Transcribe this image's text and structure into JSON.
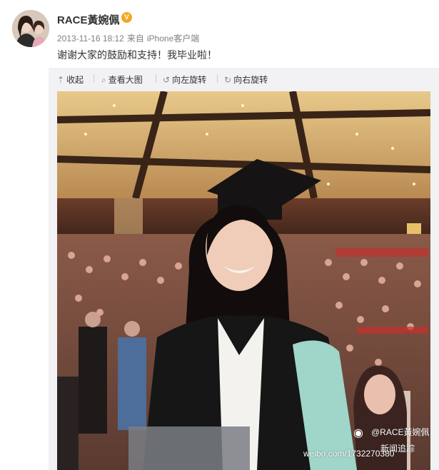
{
  "post": {
    "username": "RACE黃婉佩",
    "verified_icon": "verified-badge-icon",
    "time": "2013-11-16 18:12",
    "source_prefix": "来自",
    "source": "iPhone客户端",
    "text": "谢谢大家的鼓励和支持！我毕业啦！"
  },
  "toolbar": {
    "collapse": "收起",
    "view_large": "查看大图",
    "rotate_left": "向左旋转",
    "rotate_right": "向右旋转"
  },
  "watermark": {
    "name": "@RACE黃婉佩",
    "url": "weibo.com/1732270380",
    "badge": "新闻追踪"
  },
  "colors": {
    "card_bg": "#f2f2f5",
    "verified": "#f5a623",
    "gown": "#161616",
    "hood_trim": "#9fd6c9"
  }
}
